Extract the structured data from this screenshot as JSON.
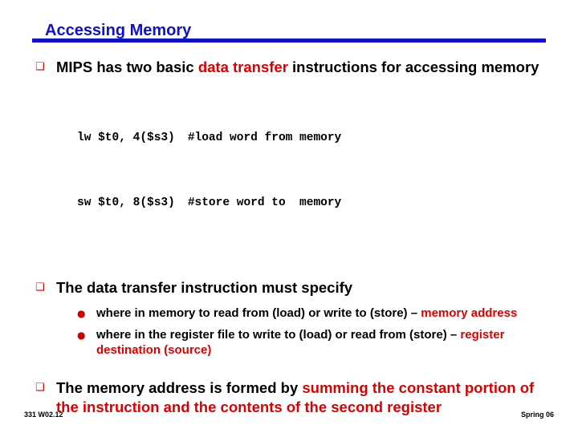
{
  "slide": {
    "title": "Accessing Memory",
    "bullets": {
      "q1": {
        "glyph": "❑",
        "text_before": "MIPS has two basic ",
        "highlight": "data transfer",
        "text_after": " instructions for accessing memory"
      },
      "code": [
        {
          "instruction": "lw $t0, 4($s3)",
          "comment": "#load word from memory"
        },
        {
          "instruction": "sw $t0, 8($s3)",
          "comment": "#store word to  memory"
        }
      ],
      "q2": {
        "glyph": "❑",
        "text": "The data transfer instruction must specify"
      },
      "sub": [
        {
          "glyph": "●",
          "text_before": "where in memory to read from (load) or write to (store) – ",
          "highlight": "memory address",
          "text_after": ""
        },
        {
          "glyph": "●",
          "text_before": "where in the register file to write to (load) or read from (store) – ",
          "highlight": "register destination (source)",
          "text_after": ""
        }
      ],
      "q3": {
        "glyph": "❑",
        "text_before": "The memory address is formed by ",
        "highlight": "summing the constant portion of the instruction and the contents of the second register",
        "text_after": ""
      }
    },
    "footer": {
      "left": "331  W02.12",
      "right": "Spring 06"
    }
  }
}
